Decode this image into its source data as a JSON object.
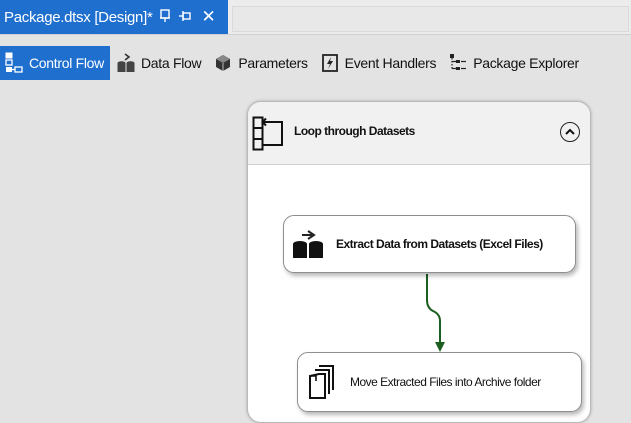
{
  "document_tab": {
    "title": "Package.dtsx [Design]*",
    "pin_glyph": "⊕",
    "close_glyph": "✕"
  },
  "designer_tabs": [
    {
      "label": "Control Flow",
      "icon": "control-flow-icon",
      "active": true
    },
    {
      "label": "Data Flow",
      "icon": "data-flow-icon",
      "active": false
    },
    {
      "label": "Parameters",
      "icon": "parameters-icon",
      "active": false
    },
    {
      "label": "Event Handlers",
      "icon": "event-handlers-icon",
      "active": false
    },
    {
      "label": "Package Explorer",
      "icon": "package-explorer-icon",
      "active": false
    }
  ],
  "container": {
    "title": "Loop through Datasets",
    "icon": "foreach-loop-icon",
    "collapse_icon": "chevron-up-circle-icon"
  },
  "tasks": [
    {
      "label": "Extract Data from Datasets (Excel Files)",
      "icon": "data-flow-task-icon"
    },
    {
      "label": "Move Extracted Files into Archive folder",
      "icon": "file-system-task-icon"
    }
  ],
  "colors": {
    "accent": "#1f6fcf",
    "canvas": "#e3e3e3",
    "connector": "#1b5e20"
  }
}
